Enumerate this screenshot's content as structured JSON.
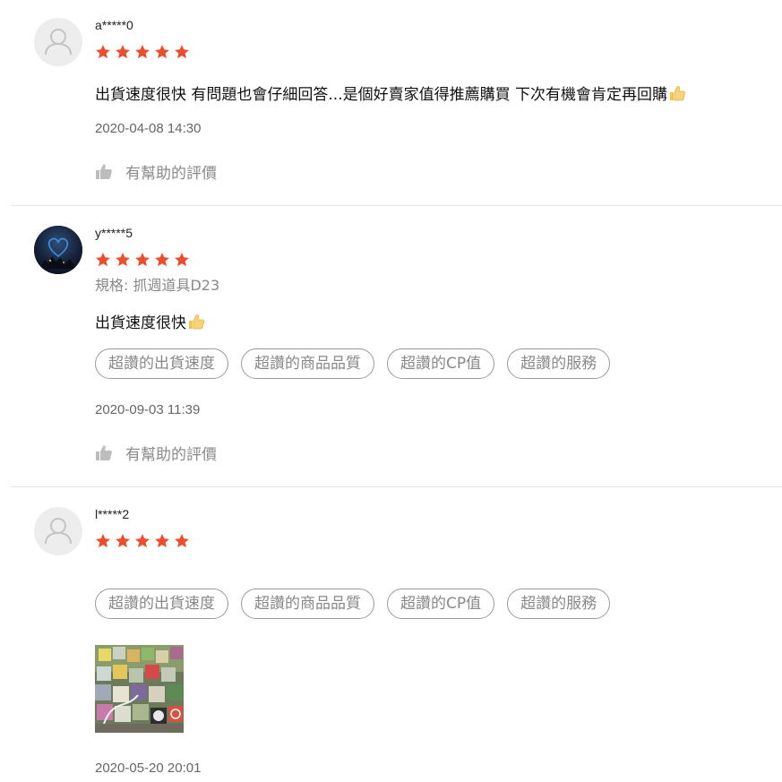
{
  "colors": {
    "star": "#ee4d2d",
    "tag_border": "#9a9a9a",
    "muted_text": "#888888",
    "divider": "#e6e6e6"
  },
  "reviews": [
    {
      "username": "a*****0",
      "rating": 5,
      "avatar": "default-user-icon",
      "content": "出貨速度很快 有問題也會仔細回答...是個好賣家值得推薦購買 下次有機會肯定再回購",
      "content_emoji": "thumbs-up-icon",
      "date": "2020-04-08 14:30",
      "helpful_label": "有幫助的評價"
    },
    {
      "username": "y*****5",
      "rating": 5,
      "avatar": "photo-avatar",
      "variant": "規格: 抓週道具D23",
      "content": "出貨速度很快",
      "content_emoji": "thumbs-up-icon",
      "tags": [
        "超讚的出貨速度",
        "超讚的商品品質",
        "超讚的CP值",
        "超讚的服務"
      ],
      "date": "2020-09-03 11:39",
      "helpful_label": "有幫助的評價"
    },
    {
      "username": "l*****2",
      "rating": 5,
      "avatar": "default-user-icon",
      "tags": [
        "超讚的出貨速度",
        "超讚的商品品質",
        "超讚的CP值",
        "超讚的服務"
      ],
      "photos": [
        "review-photo"
      ],
      "date": "2020-05-20 20:01"
    }
  ]
}
